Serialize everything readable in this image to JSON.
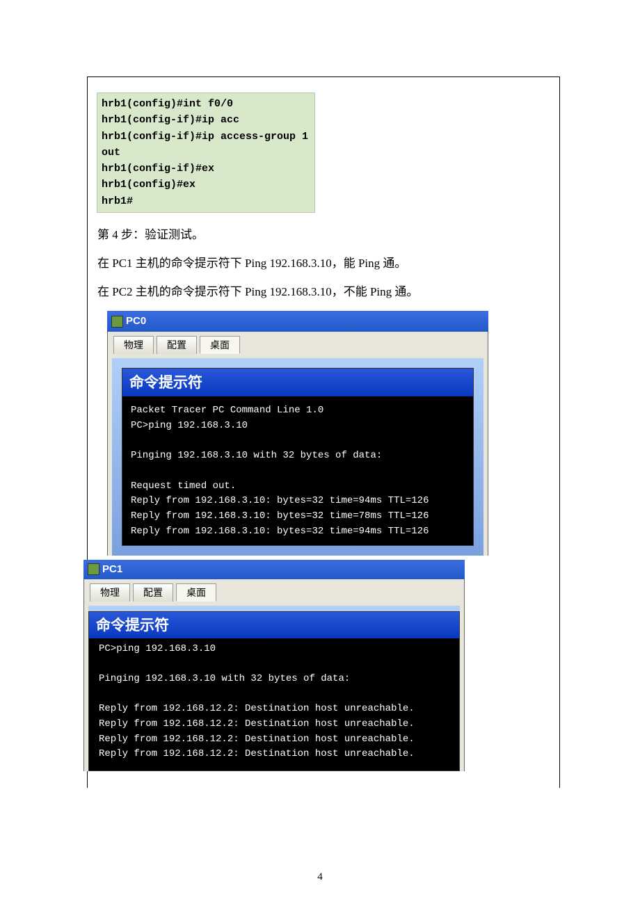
{
  "router_lines": [
    "hrb1(config)#int f0/0",
    "hrb1(config-if)#ip acc",
    "hrb1(config-if)#ip access-group 1 out",
    "hrb1(config-if)#ex",
    "hrb1(config)#ex",
    "hrb1#"
  ],
  "step4_title": "第 4 步：验证测试。",
  "body_line1": "在 PC1 主机的命令提示符下 Ping 192.168.3.10，能 Ping 通。",
  "body_line2": "在 PC2 主机的命令提示符下 Ping 192.168.3.10，不能 Ping 通。",
  "tab_labels": {
    "physical": "物理",
    "config": "配置",
    "desktop": "桌面"
  },
  "cmd_prompt_title": "命令提示符",
  "pc0": {
    "title": "PC0",
    "output": "Packet Tracer PC Command Line 1.0\nPC>ping 192.168.3.10\n\nPinging 192.168.3.10 with 32 bytes of data:\n\nRequest timed out.\nReply from 192.168.3.10: bytes=32 time=94ms TTL=126\nReply from 192.168.3.10: bytes=32 time=78ms TTL=126\nReply from 192.168.3.10: bytes=32 time=94ms TTL=126"
  },
  "pc1": {
    "title": "PC1",
    "output": "PC>ping 192.168.3.10\n\nPinging 192.168.3.10 with 32 bytes of data:\n\nReply from 192.168.12.2: Destination host unreachable.\nReply from 192.168.12.2: Destination host unreachable.\nReply from 192.168.12.2: Destination host unreachable.\nReply from 192.168.12.2: Destination host unreachable."
  },
  "page_number": "4"
}
